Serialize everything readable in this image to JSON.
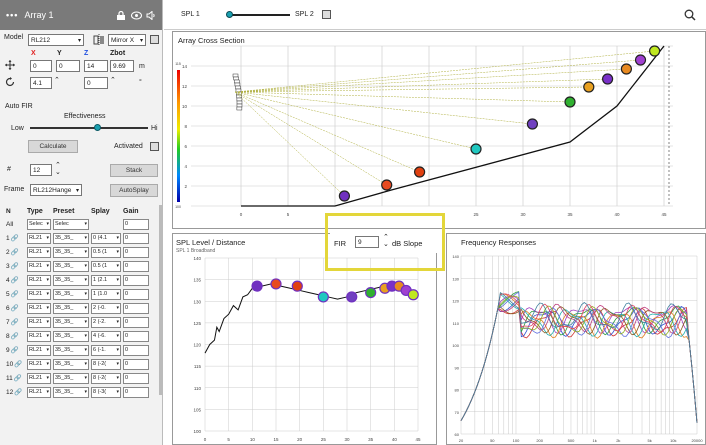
{
  "header": {
    "title": "Array 1"
  },
  "model": {
    "label": "Model",
    "value": "RL212",
    "mirror": "Mirror X"
  },
  "coords": {
    "x_label": "X",
    "y_label": "Y",
    "z_label": "Z",
    "zbot_label": "Zbot",
    "x": "0",
    "y": "0",
    "z": "14",
    "zbot": "9.69",
    "unit_m": "m",
    "rot1": "4.1",
    "rot2": "0",
    "unit_deg": "°"
  },
  "autofir": {
    "title": "Auto FIR",
    "effectiveness": "Effectiveness",
    "low": "Low",
    "high": "Hi",
    "calculate": "Calculate",
    "activated": "Activated",
    "effectiveness_level": 0.58
  },
  "stack": {
    "count_label": "#",
    "count": "12",
    "stack_button": "Stack"
  },
  "frame": {
    "label": "Frame",
    "value": "RL212Hange",
    "autosplay": "AutoSplay"
  },
  "table": {
    "headers": [
      "N",
      "Type",
      "Preset",
      "Splay",
      "Gain"
    ],
    "all_row": {
      "n": "All",
      "type": "Selec",
      "preset": "Selec",
      "gain": "0"
    },
    "rows": [
      {
        "n": "1",
        "type": "RL21",
        "preset": "35_35_",
        "splay": "0 (4.1",
        "gain": "0"
      },
      {
        "n": "2",
        "type": "RL21",
        "preset": "35_35_",
        "splay": "0.5 (1",
        "gain": "0"
      },
      {
        "n": "3",
        "type": "RL21",
        "preset": "35_35_",
        "splay": "0.5 (1",
        "gain": "0"
      },
      {
        "n": "4",
        "type": "RL21",
        "preset": "35_35_",
        "splay": "1 (2.1",
        "gain": "0"
      },
      {
        "n": "5",
        "type": "RL21",
        "preset": "35_35_",
        "splay": "1 (1.0",
        "gain": "0"
      },
      {
        "n": "6",
        "type": "RL21",
        "preset": "35_35_",
        "splay": "2 (-0.",
        "gain": "0"
      },
      {
        "n": "7",
        "type": "RL21",
        "preset": "35_35_",
        "splay": "2 (-2.",
        "gain": "0"
      },
      {
        "n": "8",
        "type": "RL21",
        "preset": "35_35_",
        "splay": "4 (-6.",
        "gain": "0"
      },
      {
        "n": "9",
        "type": "RL21",
        "preset": "35_35_",
        "splay": "6 (-1.",
        "gain": "0"
      },
      {
        "n": "10",
        "type": "RL21",
        "preset": "35_35_",
        "splay": "8 (-2(",
        "gain": "0"
      },
      {
        "n": "11",
        "type": "RL21",
        "preset": "35_35_",
        "splay": "8 (-2(",
        "gain": "0"
      },
      {
        "n": "12",
        "type": "RL21",
        "preset": "35_35_",
        "splay": "8 (-3(",
        "gain": "0"
      }
    ]
  },
  "topbar": {
    "spl1": "SPL 1",
    "spl2": "SPL 2"
  },
  "fir": {
    "label": "FIR",
    "value": "9",
    "slope": "dB Slope"
  },
  "colors": {
    "accent_yellow": "#e3d63a",
    "header_gray": "#7a7a7a",
    "x_red": "#e02020",
    "z_blue": "#2050e0"
  },
  "chart_data": [
    {
      "type": "scatter",
      "title": "Array Cross Section",
      "ylim": [
        0,
        16
      ],
      "yticks": [
        "0",
        "2",
        "4",
        "6",
        "8",
        "10",
        "12",
        "14",
        "16"
      ],
      "xticks": [
        "0",
        "5",
        "10",
        "15",
        "20",
        "25",
        "30",
        "35",
        "40",
        "45"
      ],
      "colorbar_ticks": [
        "115",
        "100"
      ],
      "venue_profile": [
        [
          0,
          0
        ],
        [
          10,
          0
        ],
        [
          16,
          1.6
        ],
        [
          35,
          6.4
        ],
        [
          40,
          10
        ],
        [
          45,
          16
        ]
      ],
      "points": [
        {
          "x": 11,
          "y": 1,
          "color": "#7030c0"
        },
        {
          "x": 15.5,
          "y": 2.1,
          "color": "#e84a20"
        },
        {
          "x": 19,
          "y": 3.4,
          "color": "#e04010"
        },
        {
          "x": 25,
          "y": 5.7,
          "color": "#20c8c0"
        },
        {
          "x": 31,
          "y": 8.2,
          "color": "#7040c0"
        },
        {
          "x": 35,
          "y": 10.4,
          "color": "#30b030"
        },
        {
          "x": 37,
          "y": 11.9,
          "color": "#e8a020"
        },
        {
          "x": 39,
          "y": 12.7,
          "color": "#7a30c8"
        },
        {
          "x": 41,
          "y": 13.7,
          "color": "#e88a20"
        },
        {
          "x": 42.5,
          "y": 14.6,
          "color": "#a040d0"
        },
        {
          "x": 44,
          "y": 15.5,
          "color": "#c0e820"
        }
      ]
    },
    {
      "type": "line",
      "title": "SPL Level / Distance",
      "subtitle": "SPL 1 Broadband",
      "ylim": [
        100,
        140
      ],
      "yticks": [
        "100",
        "105",
        "110",
        "115",
        "120",
        "125",
        "130",
        "135",
        "140"
      ],
      "xticks": [
        "0",
        "5",
        "10",
        "15",
        "20",
        "25",
        "30",
        "35",
        "40",
        "45"
      ],
      "x": [
        0,
        1,
        2,
        2.5,
        3,
        4,
        5,
        6,
        7,
        8,
        9,
        10,
        11,
        12,
        14,
        16,
        18,
        20,
        22,
        24,
        26,
        28,
        30,
        32,
        34,
        36,
        38,
        40,
        42,
        44
      ],
      "y": [
        118,
        120,
        121,
        124,
        123,
        126,
        127,
        129,
        128,
        131,
        131.5,
        133,
        133.5,
        133.5,
        134,
        133.5,
        133,
        132.5,
        132,
        131.5,
        131,
        130.5,
        131,
        132,
        132.5,
        133,
        133.5,
        133,
        132,
        131
      ],
      "points": [
        {
          "x": 11,
          "y": 133.5,
          "color": "#7030c0"
        },
        {
          "x": 15,
          "y": 134,
          "color": "#e84a20"
        },
        {
          "x": 19.5,
          "y": 133.5,
          "color": "#e04010"
        },
        {
          "x": 25,
          "y": 131,
          "color": "#20c8c0"
        },
        {
          "x": 31,
          "y": 131,
          "color": "#7040c0"
        },
        {
          "x": 35,
          "y": 132,
          "color": "#30b030"
        },
        {
          "x": 38,
          "y": 133,
          "color": "#e8a020"
        },
        {
          "x": 39.5,
          "y": 133.5,
          "color": "#7a30c8"
        },
        {
          "x": 41,
          "y": 133.5,
          "color": "#e88a20"
        },
        {
          "x": 42.5,
          "y": 132.5,
          "color": "#a040d0"
        },
        {
          "x": 44,
          "y": 131.5,
          "color": "#c0e820"
        }
      ]
    },
    {
      "type": "line",
      "title": "Frequency Responses",
      "ylim": [
        60,
        140
      ],
      "yticks": [
        "60",
        "70",
        "80",
        "90",
        "100",
        "110",
        "120",
        "130",
        "140"
      ],
      "xticks": [
        "20",
        "50",
        "100",
        "200",
        "500",
        "1k",
        "2k",
        "5k",
        "10k",
        "20000"
      ],
      "log_x": true,
      "series_colors": [
        "#d03030",
        "#3050d0",
        "#30a040",
        "#a040c0",
        "#e08020",
        "#20b0b0",
        "#8a5a20",
        "#c04080",
        "#6070e0",
        "#90b020",
        "#e04060",
        "#4080a0"
      ]
    }
  ]
}
